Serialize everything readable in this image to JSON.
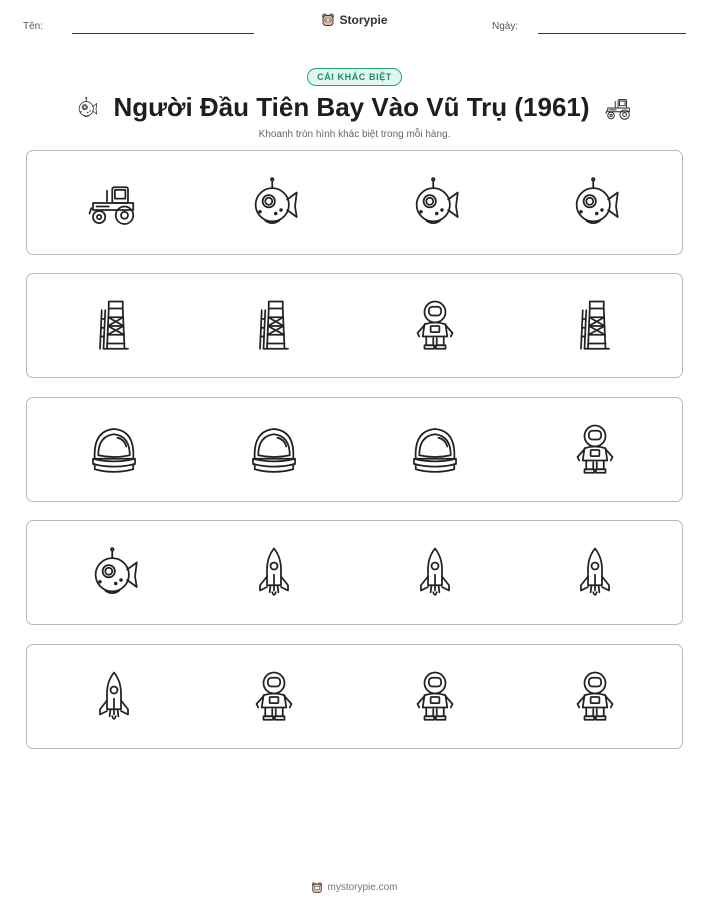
{
  "header": {
    "name_label": "Tên:",
    "date_label": "Ngày:",
    "brand": "Storypie"
  },
  "badge": "CÁI KHÁC BIỆT",
  "title": "Người Đầu Tiên Bay Vào Vũ Trụ (1961)",
  "title_icons": [
    "submarine-icon",
    "tractor-icon"
  ],
  "instruction": "Khoanh tròn hình khác biệt trong mỗi hàng.",
  "rows": [
    {
      "items": [
        "tractor",
        "submarine",
        "submarine",
        "submarine"
      ],
      "odd_index": 0
    },
    {
      "items": [
        "launch-tower",
        "launch-tower",
        "astronaut",
        "launch-tower"
      ],
      "odd_index": 2
    },
    {
      "items": [
        "space-helmet",
        "space-helmet",
        "space-helmet",
        "astronaut"
      ],
      "odd_index": 3
    },
    {
      "items": [
        "submarine",
        "rocket",
        "rocket",
        "rocket"
      ],
      "odd_index": 0
    },
    {
      "items": [
        "rocket",
        "astronaut",
        "astronaut",
        "astronaut"
      ],
      "odd_index": 0
    }
  ],
  "footer": {
    "text": "mystorypie.com"
  }
}
